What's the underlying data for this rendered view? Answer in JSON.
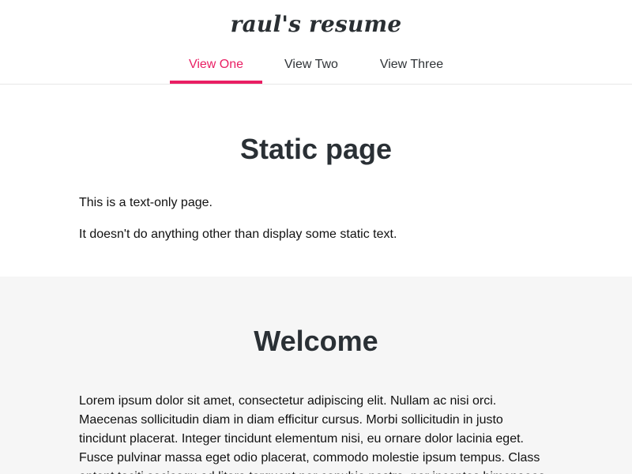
{
  "header": {
    "brand": "raul's resume",
    "tabs": [
      {
        "label": "View One",
        "active": true
      },
      {
        "label": "View Two",
        "active": false
      },
      {
        "label": "View Three",
        "active": false
      }
    ]
  },
  "static_section": {
    "title": "Static page",
    "paragraphs": [
      "This is a text-only page.",
      "It doesn't do anything other than display some static text."
    ]
  },
  "welcome_section": {
    "title": "Welcome",
    "body": "Lorem ipsum dolor sit amet, consectetur adipiscing elit. Nullam ac nisi orci. Maecenas sollicitudin diam in diam efficitur cursus. Morbi sollicitudin in justo tincidunt placerat. Integer tincidunt elementum nisi, eu ornare dolor lacinia eget. Fusce pulvinar massa eget odio placerat, commodo molestie ipsum tempus. Class aptent taciti sociosqu ad litora torquent per conubia nostra, per inceptos himenaeos."
  },
  "theme": {
    "accent": "#e91e63",
    "header_border": "#e6e6e6",
    "alternate_section_background": "#f6f6f6"
  }
}
